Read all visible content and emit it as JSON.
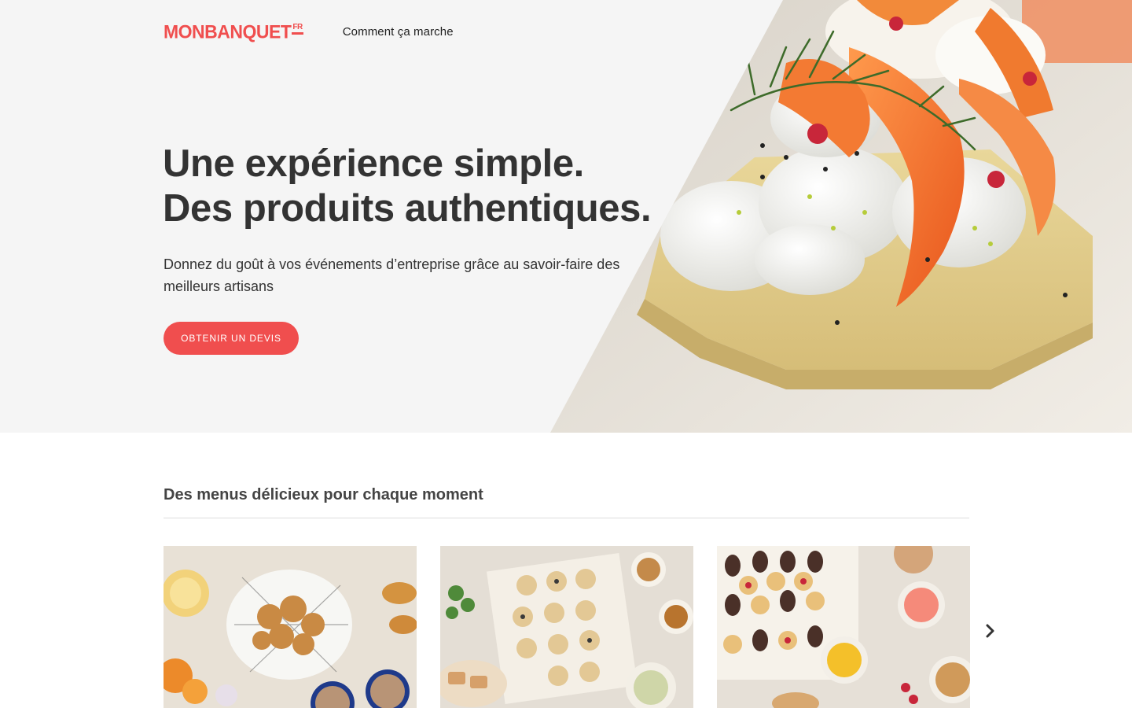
{
  "header": {
    "logo_text": "MONBANQUET",
    "logo_suffix": "FR",
    "nav_link": "Comment ça marche"
  },
  "hero": {
    "title_line1": "Une expérience simple.",
    "title_line2": "Des produits authentiques.",
    "subtitle": "Donnez du goût à vos événements d’entreprise grâce au savoir-faire des meilleurs artisans",
    "cta_label": "OBTENIR UN DEVIS"
  },
  "menus": {
    "title": "Des menus délicieux pour chaque moment",
    "next_icon": "chevron-right-icon"
  },
  "colors": {
    "brand": "#f04e4e",
    "hero_bg": "#f5f5f5",
    "title_text": "#333333"
  }
}
